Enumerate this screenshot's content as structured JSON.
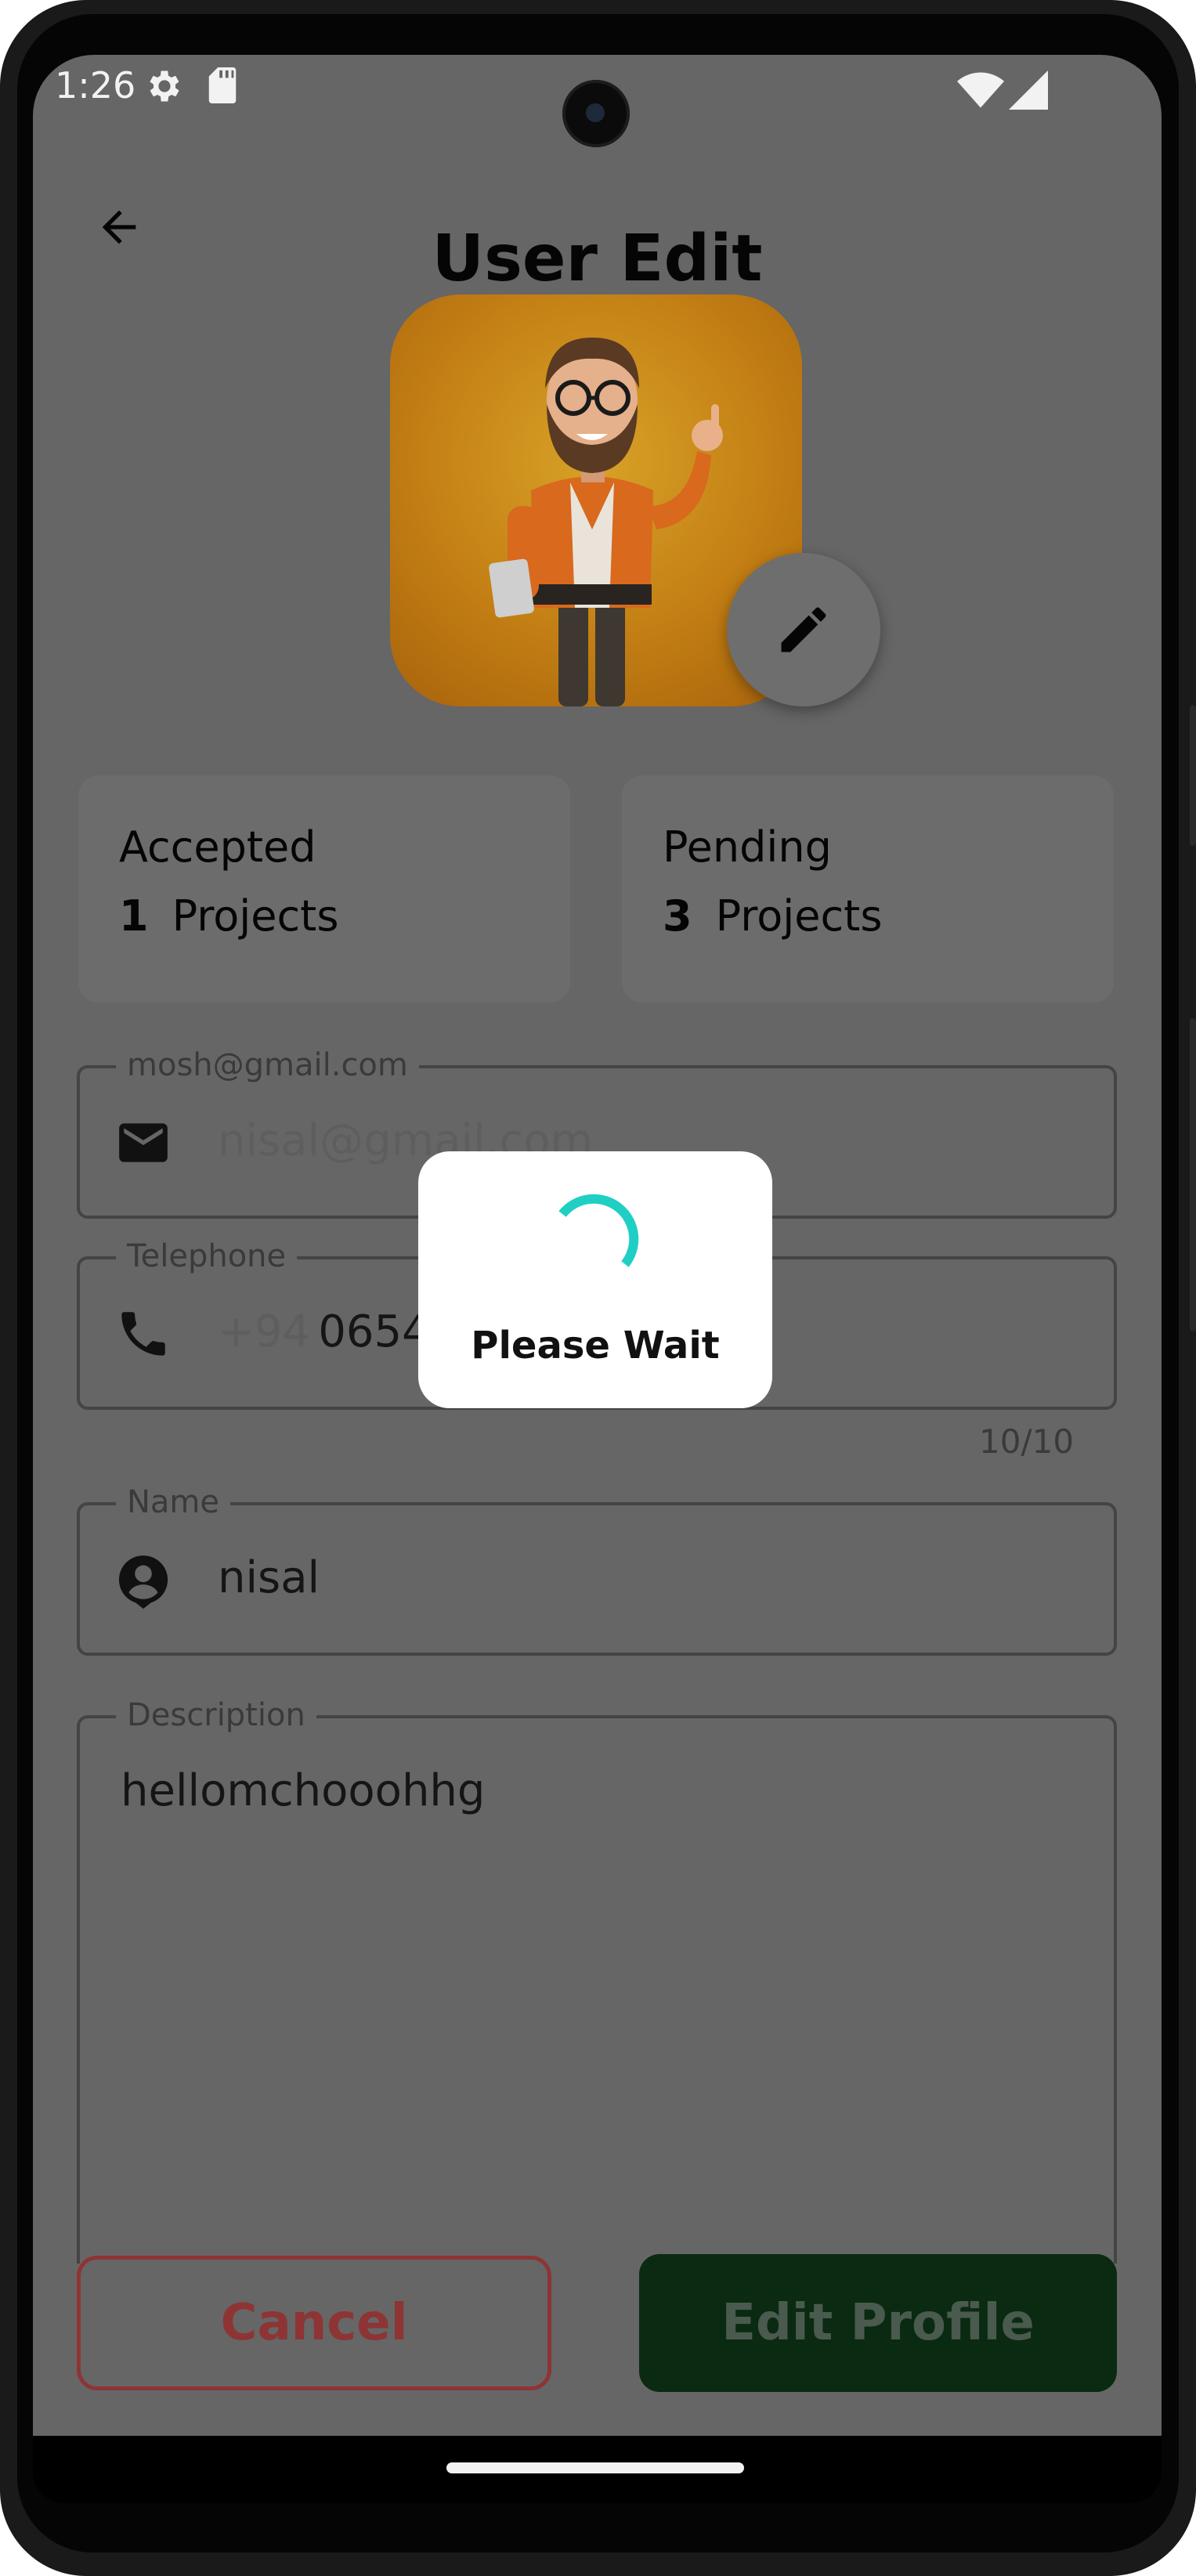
{
  "status_bar": {
    "time": "1:26",
    "icons": [
      "gear-icon",
      "sd-card-icon",
      "wifi-icon",
      "signal-icon"
    ]
  },
  "header": {
    "title": "User Edit",
    "back_icon": "arrow-left-icon"
  },
  "avatar": {
    "edit_icon": "pencil-icon"
  },
  "stats": [
    {
      "title": "Accepted",
      "count": "1",
      "unit": "Projects"
    },
    {
      "title": "Pending",
      "count": "3",
      "unit": "Projects"
    }
  ],
  "form": {
    "email": {
      "label": "mosh@gmail.com",
      "placeholder": "nisal@gmail.com",
      "icon": "mail-icon"
    },
    "telephone": {
      "label": "Telephone",
      "prefix": "+94",
      "value": "06545",
      "icon": "phone-icon",
      "counter": "10/10"
    },
    "name": {
      "label": "Name",
      "value": "nisal",
      "icon": "account-circle-icon"
    },
    "description": {
      "label": "Description",
      "value": "hellomchooohhg"
    }
  },
  "actions": {
    "cancel_label": "Cancel",
    "edit_label": "Edit Profile"
  },
  "dialog": {
    "text": "Please Wait",
    "spinner_color": "#1fcfc3"
  },
  "colors": {
    "cancel": "#8e3434",
    "edit_bg": "#0a2a12"
  }
}
